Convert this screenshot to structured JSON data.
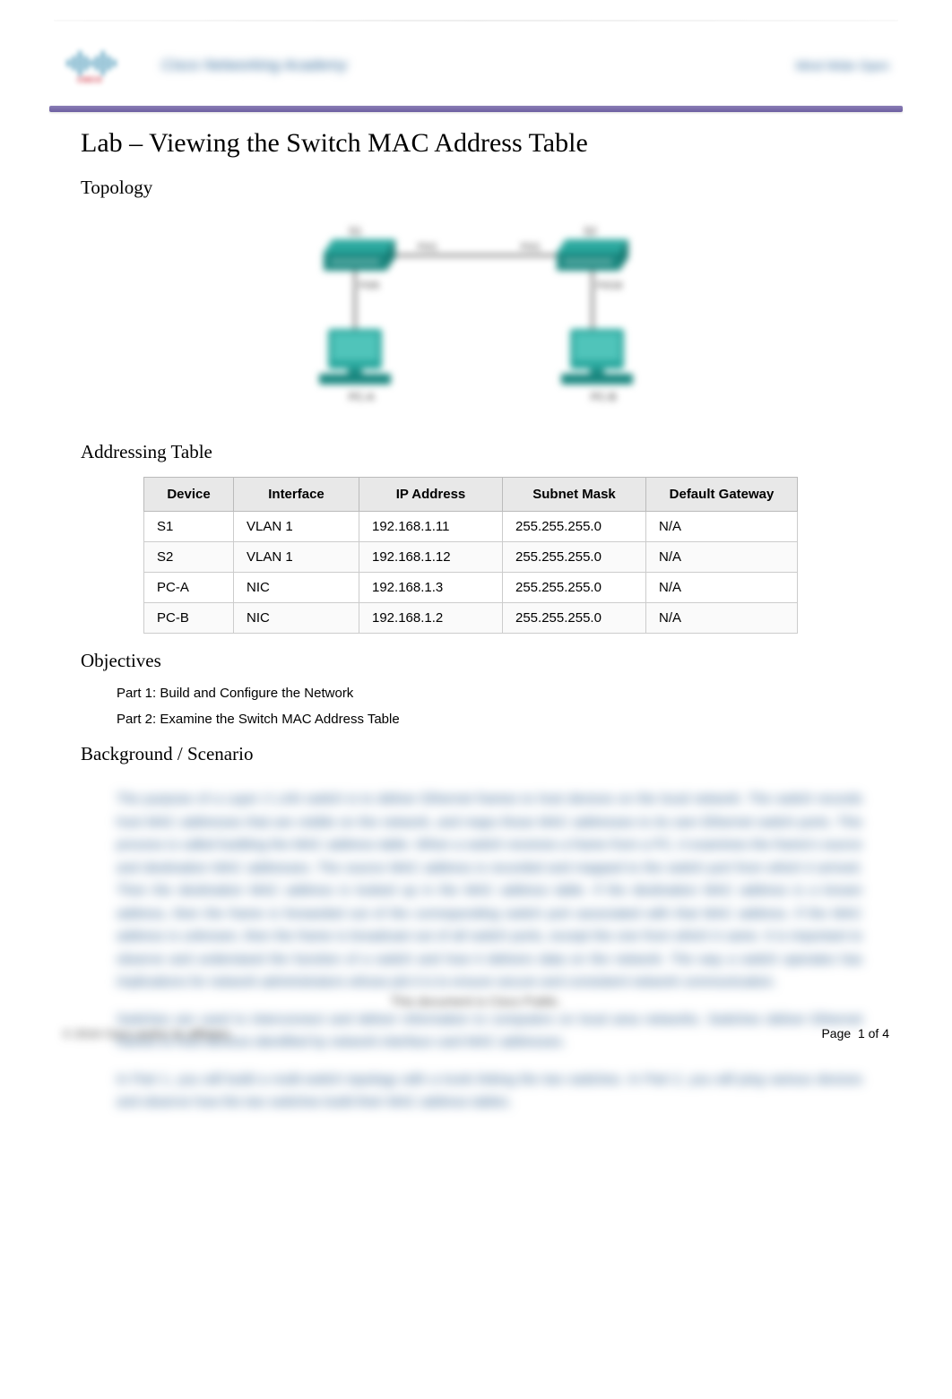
{
  "header": {
    "blurred_text_left": "Cisco Networking Academy",
    "blurred_text_right": "Mind Wide Open"
  },
  "title": "Lab – Viewing the Switch MAC Address Table",
  "sections": {
    "topology": "Topology",
    "addressing": "Addressing Table",
    "objectives": "Objectives",
    "background": "Background / Scenario"
  },
  "table": {
    "headers": [
      "Device",
      "Interface",
      "IP Address",
      "Subnet Mask",
      "Default Gateway"
    ],
    "rows": [
      [
        "S1",
        "VLAN 1",
        "192.168.1.11",
        "255.255.255.0",
        "N/A"
      ],
      [
        "S2",
        "VLAN 1",
        "192.168.1.12",
        "255.255.255.0",
        "N/A"
      ],
      [
        "PC-A",
        "NIC",
        "192.168.1.3",
        "255.255.255.0",
        "N/A"
      ],
      [
        "PC-B",
        "NIC",
        "192.168.1.2",
        "255.255.255.0",
        "N/A"
      ]
    ]
  },
  "objectives": {
    "part1": "Part 1: Build and Configure the Network",
    "part2": "Part 2: Examine the Switch MAC Address Table"
  },
  "scenario": {
    "para1": "The purpose of a Layer 2 LAN switch is to deliver Ethernet frames to host devices on the local network. The switch records host MAC addresses that are visible on the network, and maps those MAC addresses to its own Ethernet switch ports. This process is called building the MAC address table. When a switch receives a frame from a PC, it examines the frame's source and destination MAC addresses. The source MAC address is recorded and mapped to the switch port from which it arrived. Then the destination MAC address is looked up in the MAC address table. If the destination MAC address is a known address, then the frame is forwarded out of the corresponding switch port associated with that MAC address. If the MAC address is unknown, then the frame is broadcast out of all switch ports, except the one from which it came. It is important to observe and understand the function of a switch and how it delivers data on the network. The way a switch operates has implications for network administrators whose job it is to ensure secure and consistent network communication.",
    "para2": "Switches are used to interconnect and deliver information to computers on local area networks. Switches deliver Ethernet frames to host devices identified by network interface card MAC addresses.",
    "para3": "In Part 1, you will build a multi-switch topology with a trunk linking the two switches. In Part 2, you will ping various devices and observe how the two switches build their MAC address tables."
  },
  "footer": {
    "center_text": "This document is Cisco Public.",
    "left_text": "© 2016 Cisco and/or its affiliates.",
    "page_label": "Page",
    "page_current": "1",
    "page_of": "of",
    "page_total": "4"
  }
}
